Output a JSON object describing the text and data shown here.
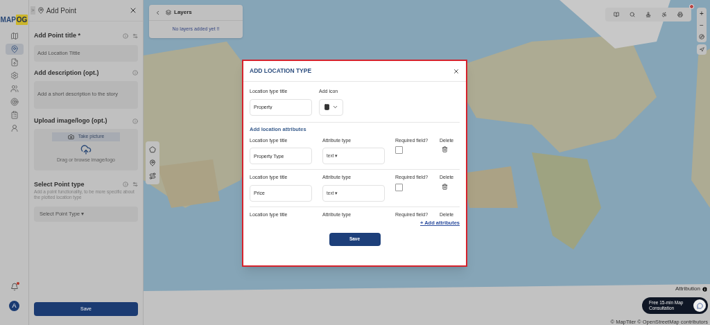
{
  "brand": {
    "logo_text": "MAP",
    "logo_accent": "OG"
  },
  "rail": {
    "items": [
      {
        "kind": "map",
        "selected": false
      },
      {
        "kind": "pin",
        "selected": true
      },
      {
        "kind": "file",
        "selected": false
      },
      {
        "kind": "gear",
        "selected": false
      },
      {
        "kind": "people",
        "selected": false
      },
      {
        "kind": "target",
        "selected": false
      },
      {
        "kind": "list",
        "selected": false
      },
      {
        "kind": "group",
        "selected": false
      }
    ],
    "notification": true,
    "avatar": "A"
  },
  "panel": {
    "breadcrumb": ">",
    "title": "Add Point",
    "point_title": {
      "label": "Add Point title *",
      "placeholder": "Add Location Tittle"
    },
    "description": {
      "label": "Add description (opt.)",
      "placeholder": "Add a short description to the story"
    },
    "upload": {
      "label": "Upload image/logo (opt.)",
      "camera_button": "Take picture",
      "hint": "Drag or browse image/logo"
    },
    "point_type": {
      "label": "Select Point type",
      "help": "Add a point functionality, to be more specific about the plotted location type",
      "placeholder": "Select Point Type ▾"
    },
    "save": "Save"
  },
  "layers": {
    "title": "Layers",
    "empty": "No layers added yet !!"
  },
  "map_tools": {
    "badge": true,
    "zoom_in": "+",
    "zoom_out": "−"
  },
  "attribution": "Attribution",
  "consult": "Free 15-min Map Consultation",
  "credits": "© MapTiler © OpenStreetMap contributors",
  "modal": {
    "title": "ADD LOCATION TYPE",
    "type_title": {
      "label": "Location type title",
      "value": "Property"
    },
    "icon": {
      "label": "Add icon"
    },
    "attributes_heading": "Add location attributes",
    "attributes": [
      {
        "kind": "full",
        "title_label": "Location type title",
        "name": "Property Type",
        "type_label": "Attribute type",
        "type": "text ▾",
        "required_label": "Required field?",
        "required": false,
        "delete_label": "Delete"
      },
      {
        "kind": "full",
        "title_label": "Location type title",
        "name": "Price",
        "type_label": "Attribute type",
        "type": "text ▾",
        "required_label": "Required field?",
        "required": false,
        "delete_label": "Delete"
      },
      {
        "kind": "header",
        "title_label": "Location type title",
        "type_label": "Attribute type",
        "required_label": "Required field?",
        "delete_label": "Delete"
      }
    ],
    "add_link": "+ Add attributes",
    "save": "Save"
  }
}
